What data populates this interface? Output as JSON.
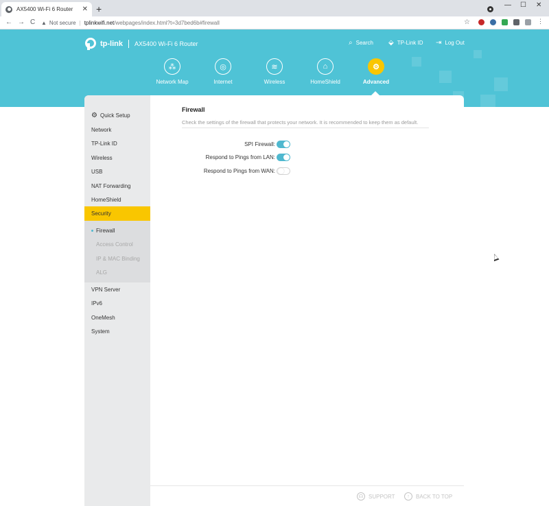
{
  "browser": {
    "tab_title": "AX5400 Wi-Fi 6 Router",
    "tab_close": "✕",
    "new_tab": "+",
    "window_controls": {
      "minimize": "—",
      "maximize": "☐",
      "close": "✕"
    },
    "back": "←",
    "forward": "→",
    "reload": "C",
    "security_label": "Not secure",
    "url_host": "tplinkwifi.net",
    "url_path": "/webpages/index.html?t=3d7bed6b#firewall",
    "bookmark_star": "☆"
  },
  "header": {
    "brand": "tp-link",
    "model": "AX5400 Wi-Fi 6 Router",
    "links": [
      {
        "label": "Search",
        "icon": "⌕"
      },
      {
        "label": "TP-Link ID",
        "icon": "⬙"
      },
      {
        "label": "Log Out",
        "icon": "⇥"
      }
    ],
    "nav": [
      {
        "label": "Network Map",
        "icon": "⁂"
      },
      {
        "label": "Internet",
        "icon": "◎"
      },
      {
        "label": "Wireless",
        "icon": "≋"
      },
      {
        "label": "HomeShield",
        "icon": "⌂"
      },
      {
        "label": "Advanced",
        "icon": "⚙"
      }
    ],
    "active_nav": "Advanced",
    "accent_color": "#4fc3d6",
    "active_color": "#f9c600"
  },
  "sidebar": {
    "quick_setup_icon": "⚙",
    "items": [
      "Quick Setup",
      "Network",
      "TP-Link ID",
      "Wireless",
      "USB",
      "NAT Forwarding",
      "HomeShield",
      "Security"
    ],
    "selected": "Security",
    "sub_items": [
      "Firewall",
      "Access Control",
      "IP & MAC Binding",
      "ALG"
    ],
    "active_sub": "Firewall",
    "items_after": [
      "VPN Server",
      "IPv6",
      "OneMesh",
      "System"
    ]
  },
  "content": {
    "title": "Firewall",
    "description": "Check the settings of the firewall that protects your network. It is recommended to keep them as default.",
    "settings": [
      {
        "label": "SPI Firewall:",
        "enabled": true
      },
      {
        "label": "Respond to Pings from LAN:",
        "enabled": true
      },
      {
        "label": "Respond to Pings from WAN:",
        "enabled": false
      }
    ]
  },
  "footer": {
    "support": "SUPPORT",
    "support_icon": "☊",
    "back_to_top": "BACK TO TOP",
    "back_to_top_icon": "↑"
  }
}
